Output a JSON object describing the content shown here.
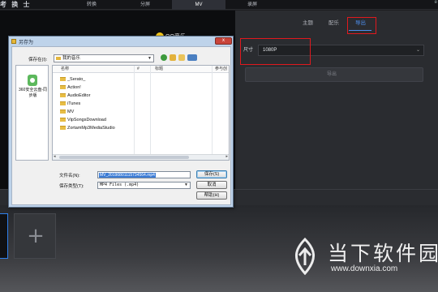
{
  "app": {
    "title": "考 换 士",
    "nav": [
      "转换",
      "分屏",
      "MV",
      "录屏"
    ],
    "nav_active": "MV",
    "corner": "e"
  },
  "preview": {
    "logo_text": "QQ音乐"
  },
  "right_panel": {
    "tabs": [
      "主题",
      "配乐",
      "导出"
    ],
    "active_tab": "导出",
    "size_label": "尺寸",
    "size_value": "1080P",
    "export_button": "导出"
  },
  "dialog": {
    "title": "另存为",
    "close_label": "x",
    "save_in_label": "保存在(I):",
    "current_folder": "我的音乐",
    "places": [
      {
        "label": "360安全云盘-同步版"
      }
    ],
    "columns": [
      "名称",
      "#",
      "标题",
      "参与创"
    ],
    "folders": [
      "_Serato_",
      "Action!",
      "AudioEditor",
      "iTunes",
      "MV",
      "VipSongsDownload",
      "ZortamMp3MediaStudio"
    ],
    "filename_label": "文件名(N):",
    "filename_value": "MV_20190801115734564.mp4",
    "filetype_label": "保存类型(T):",
    "filetype_value": "MP4 Files (.mp4)",
    "buttons": {
      "save": "保存(S)",
      "cancel": "取消",
      "help": "帮助(H)"
    }
  },
  "watermark": {
    "text": "当下软件园",
    "url": "www.downxia.com"
  },
  "colors": {
    "accent": "#4d8ff0",
    "highlight": "#e0191e",
    "dialog_frame": "#bed3ea",
    "selection": "#3a7bd5"
  }
}
